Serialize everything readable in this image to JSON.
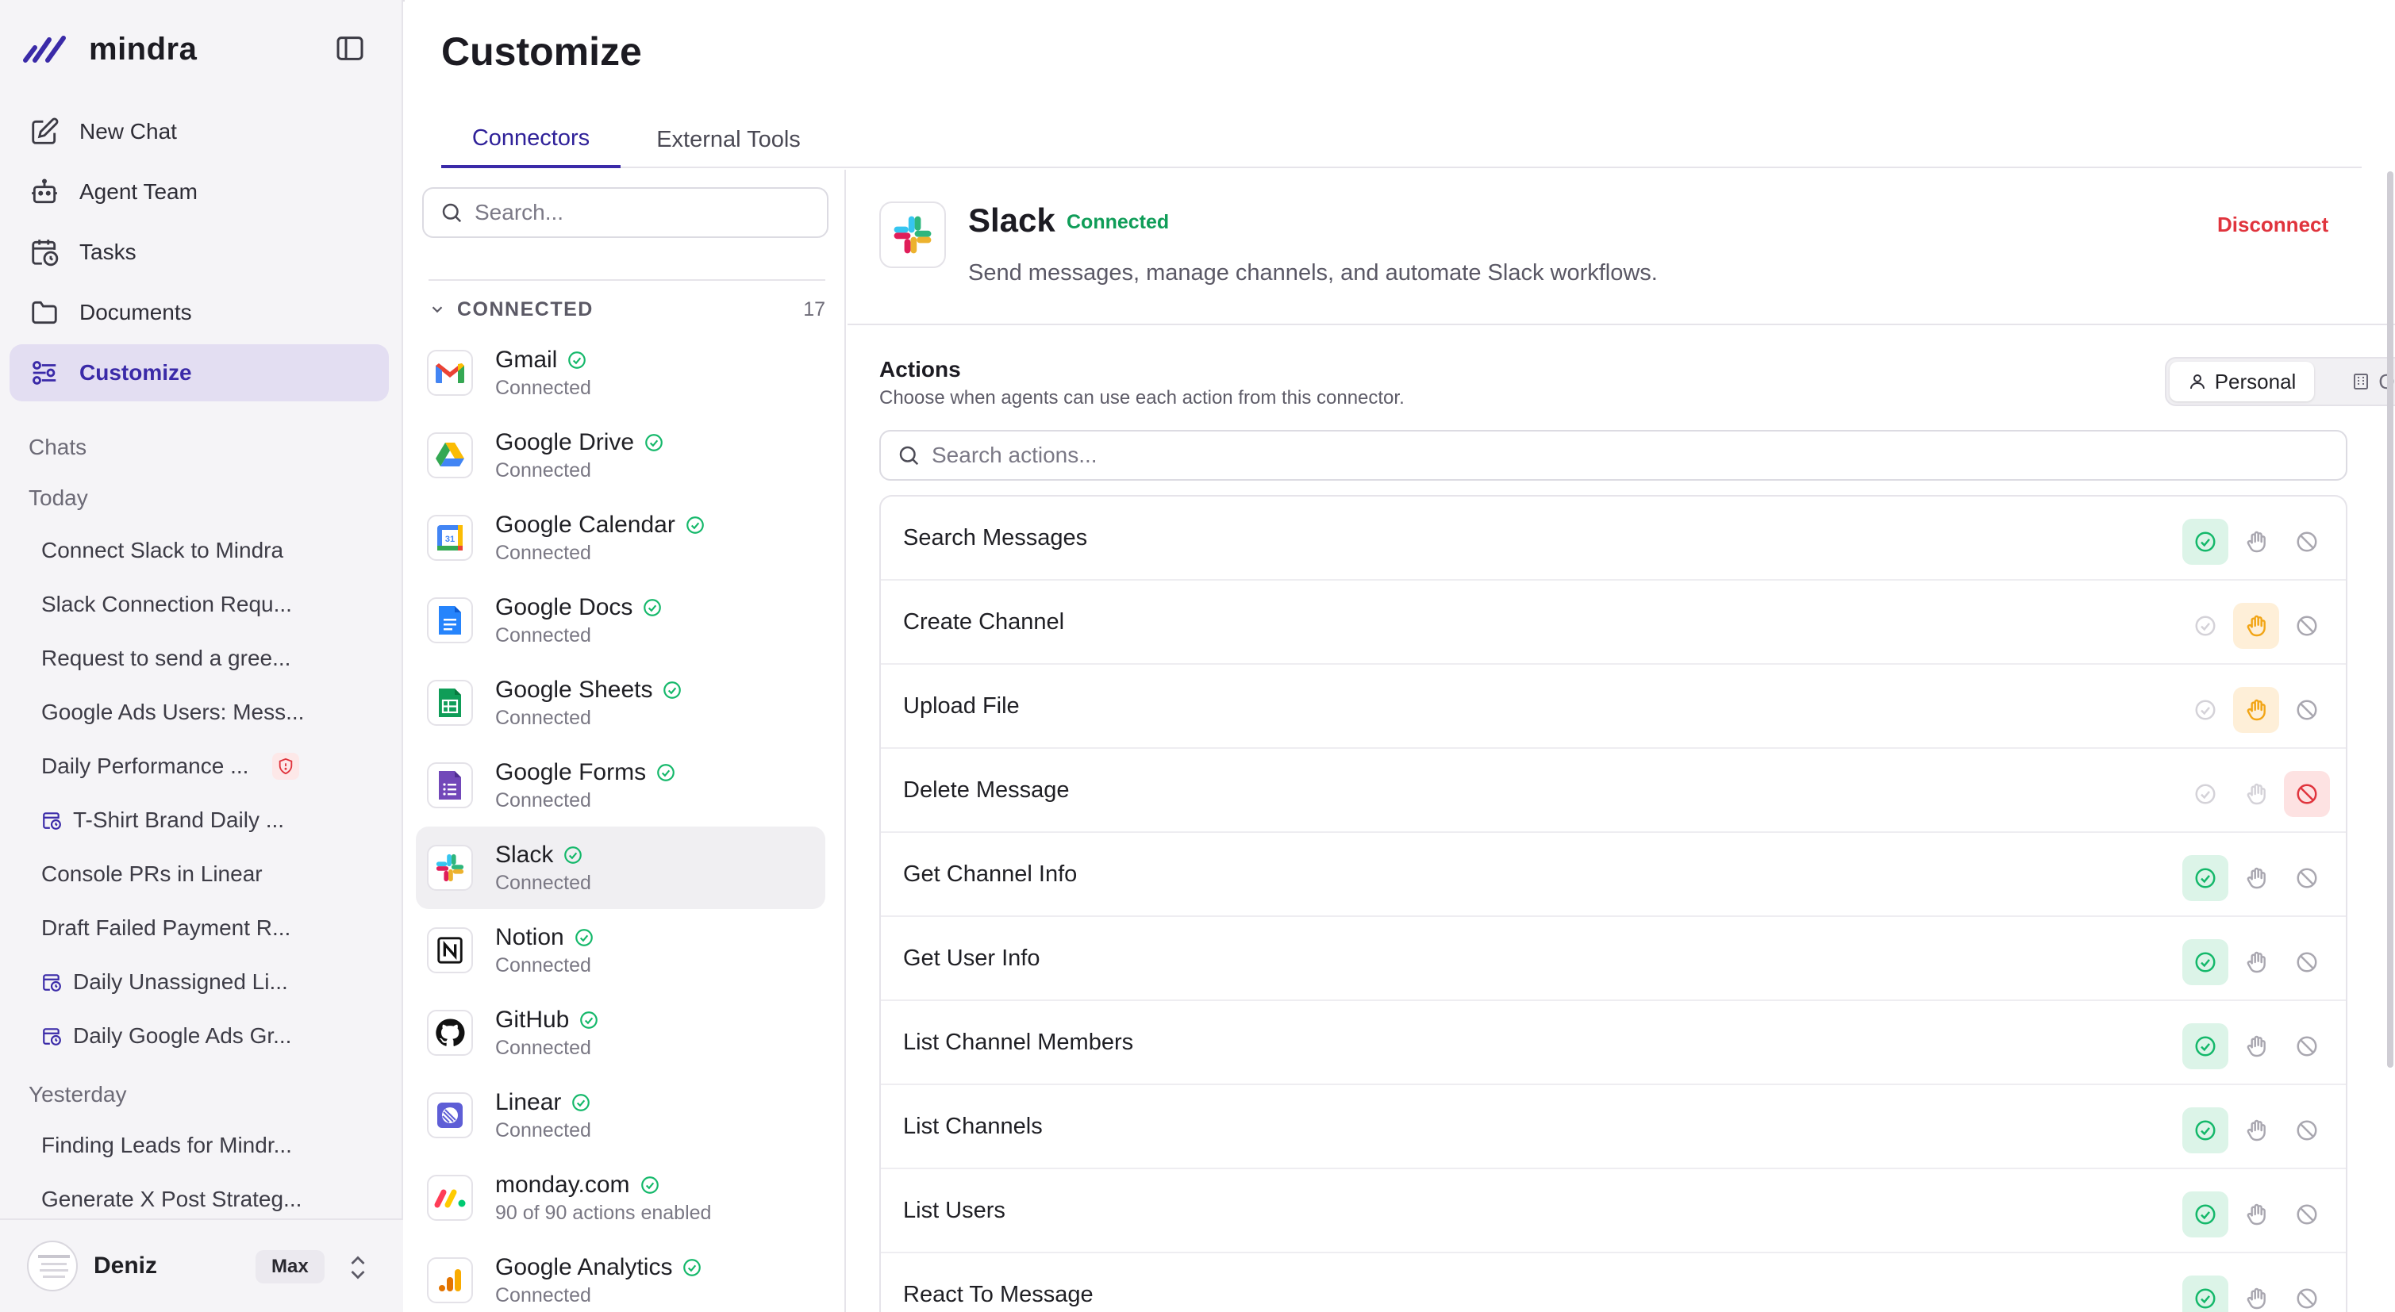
{
  "app": {
    "name": "mindra"
  },
  "colors": {
    "accent": "#3a2aa8",
    "success": "#0f9d58",
    "danger": "#e0343d",
    "warning": "#f2a516"
  },
  "nav": [
    {
      "label": "New Chat",
      "icon": "edit-icon"
    },
    {
      "label": "Agent Team",
      "icon": "robot-icon"
    },
    {
      "label": "Tasks",
      "icon": "calendar-clock-icon"
    },
    {
      "label": "Documents",
      "icon": "folder-icon"
    },
    {
      "label": "Customize",
      "icon": "sliders-icon",
      "active": true
    }
  ],
  "chats": {
    "label": "Chats",
    "today_label": "Today",
    "today": [
      {
        "title": "Connect Slack to Mindra"
      },
      {
        "title": "Slack Connection Requ..."
      },
      {
        "title": "Request to send a gree..."
      },
      {
        "title": "Google Ads Users: Mess..."
      },
      {
        "title": "Daily Performance ...",
        "badge": "shield-icon"
      },
      {
        "title": "T-Shirt Brand Daily ...",
        "scheduled": true
      },
      {
        "title": "Console PRs in Linear"
      },
      {
        "title": "Draft Failed Payment R..."
      },
      {
        "title": "Daily Unassigned Li...",
        "scheduled": true
      },
      {
        "title": "Daily Google Ads Gr...",
        "scheduled": true
      }
    ],
    "yesterday_label": "Yesterday",
    "yesterday": [
      {
        "title": "Finding Leads for Mindr..."
      },
      {
        "title": "Generate X Post Strateg..."
      }
    ]
  },
  "user": {
    "name": "Deniz",
    "plan": "Max"
  },
  "page": {
    "title": "Customize"
  },
  "tabs": [
    {
      "label": "Connectors",
      "active": true
    },
    {
      "label": "External Tools"
    }
  ],
  "connectors": {
    "search_placeholder": "Search...",
    "section_label": "CONNECTED",
    "count": "17",
    "items": [
      {
        "name": "Gmail",
        "status": "Connected",
        "logo": "gmail-logo"
      },
      {
        "name": "Google Drive",
        "status": "Connected",
        "logo": "google-drive-logo"
      },
      {
        "name": "Google Calendar",
        "status": "Connected",
        "logo": "google-calendar-logo"
      },
      {
        "name": "Google Docs",
        "status": "Connected",
        "logo": "google-docs-logo"
      },
      {
        "name": "Google Sheets",
        "status": "Connected",
        "logo": "google-sheets-logo"
      },
      {
        "name": "Google Forms",
        "status": "Connected",
        "logo": "google-forms-logo"
      },
      {
        "name": "Slack",
        "status": "Connected",
        "logo": "slack-logo",
        "active": true
      },
      {
        "name": "Notion",
        "status": "Connected",
        "logo": "notion-logo"
      },
      {
        "name": "GitHub",
        "status": "Connected",
        "logo": "github-logo"
      },
      {
        "name": "Linear",
        "status": "Connected",
        "logo": "linear-logo"
      },
      {
        "name": "monday.com",
        "status": "90 of 90 actions enabled",
        "logo": "monday-logo"
      },
      {
        "name": "Google Analytics",
        "status": "Connected",
        "logo": "google-analytics-logo"
      }
    ]
  },
  "detail": {
    "name": "Slack",
    "badge": "Connected",
    "description": "Send messages, manage channels, and automate Slack workflows.",
    "disconnect_label": "Disconnect",
    "actions_title": "Actions",
    "actions_subtitle": "Choose when agents can use each action from this connector.",
    "scope": {
      "personal": "Personal",
      "org": "Org",
      "selected": "personal"
    },
    "search_placeholder": "Search actions...",
    "actions": [
      {
        "name": "Search Messages",
        "mode": "allow"
      },
      {
        "name": "Create Channel",
        "mode": "ask"
      },
      {
        "name": "Upload File",
        "mode": "ask"
      },
      {
        "name": "Delete Message",
        "mode": "block"
      },
      {
        "name": "Get Channel Info",
        "mode": "allow"
      },
      {
        "name": "Get User Info",
        "mode": "allow"
      },
      {
        "name": "List Channel Members",
        "mode": "allow"
      },
      {
        "name": "List Channels",
        "mode": "allow"
      },
      {
        "name": "List Users",
        "mode": "allow"
      },
      {
        "name": "React To Message",
        "mode": "allow"
      }
    ]
  }
}
